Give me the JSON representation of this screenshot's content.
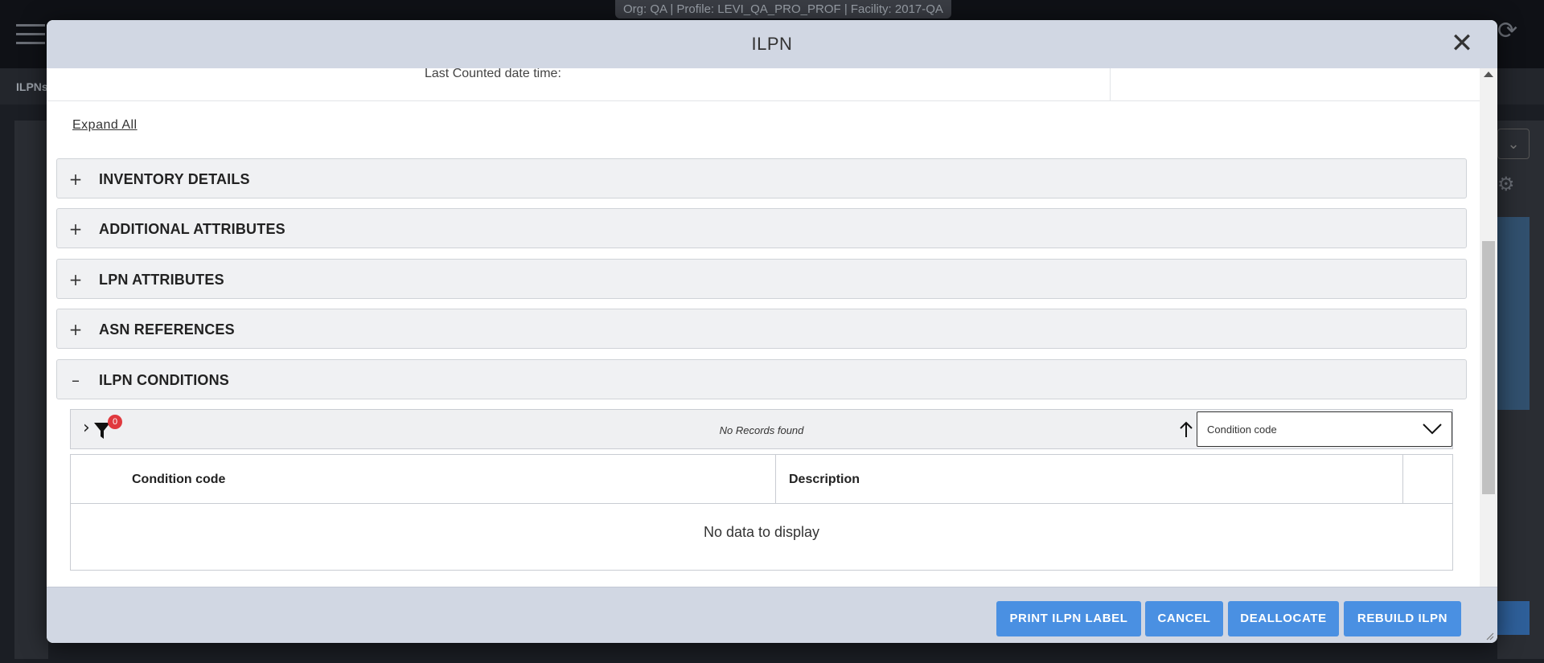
{
  "background": {
    "org_bar": "Org: QA  |  Profile: LEVI_QA_PRO_PROF  |  Facility: 2017-QA",
    "breadcrumb": "ILPNs"
  },
  "modal": {
    "title": "ILPN",
    "close_icon": "close-icon",
    "cut_off_label": "Last Counted date time:",
    "expand_all": "Expand All",
    "sections": [
      {
        "label": "INVENTORY DETAILS",
        "toggle": "+"
      },
      {
        "label": "ADDITIONAL ATTRIBUTES",
        "toggle": "+"
      },
      {
        "label": "LPN ATTRIBUTES",
        "toggle": "+"
      },
      {
        "label": "ASN REFERENCES",
        "toggle": "+"
      },
      {
        "label": "ILPN CONDITIONS",
        "toggle": "–"
      }
    ],
    "conditions": {
      "filter_count": "0",
      "no_records": "No Records found",
      "sort_field": "Condition code",
      "columns": [
        "Condition code",
        "Description"
      ],
      "empty_message": "No data to display"
    },
    "footer": {
      "print_label": "PRINT ILPN LABEL",
      "cancel": "CANCEL",
      "deallocate": "DEALLOCATE",
      "rebuild": "REBUILD ILPN"
    }
  },
  "colors": {
    "header_bg": "#d1d7e3",
    "primary_button": "#4a90e2",
    "badge": "#e0393e"
  }
}
